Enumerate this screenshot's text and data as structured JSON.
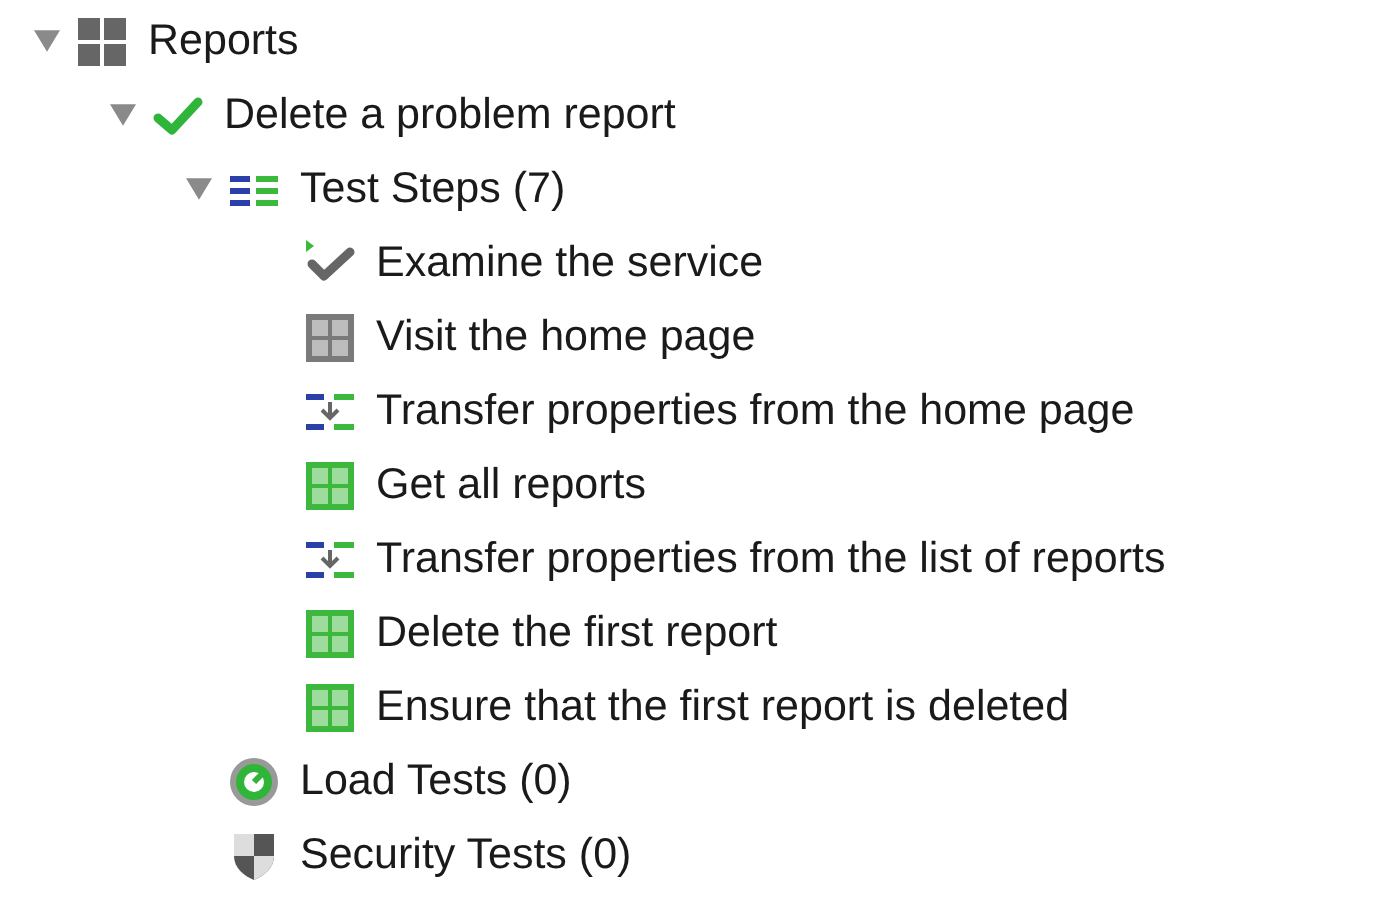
{
  "tree": [
    {
      "label": "Reports",
      "kind": "project",
      "expanded": true,
      "children": [
        {
          "label": "Delete a problem report",
          "kind": "testcase",
          "expanded": true,
          "children": [
            {
              "label": "Test Steps (7)",
              "kind": "steps",
              "expanded": true,
              "children": [
                {
                  "label": "Examine the service",
                  "kind": "assertion"
                },
                {
                  "label": "Visit the home page",
                  "kind": "request",
                  "color": "#7a7a7a"
                },
                {
                  "label": "Transfer properties from the home page",
                  "kind": "transfer"
                },
                {
                  "label": "Get all reports",
                  "kind": "request",
                  "color": "#3cb83c"
                },
                {
                  "label": "Transfer properties from the list of reports",
                  "kind": "transfer"
                },
                {
                  "label": "Delete the first report",
                  "kind": "request",
                  "color": "#3cb83c"
                },
                {
                  "label": "Ensure that the first report is deleted",
                  "kind": "request",
                  "color": "#3cb83c"
                }
              ]
            },
            {
              "label": "Load Tests (0)",
              "kind": "load"
            },
            {
              "label": "Security Tests (0)",
              "kind": "security"
            }
          ]
        }
      ]
    }
  ]
}
